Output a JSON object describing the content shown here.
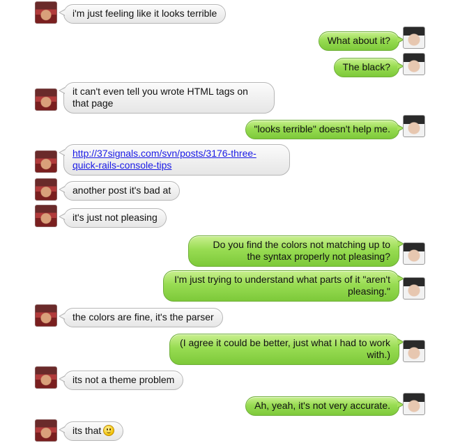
{
  "colors": {
    "them_bubble": "#e9e9e9",
    "me_bubble": "#8fd64a",
    "link": "#1a1ae6"
  },
  "messages": [
    {
      "from": "them",
      "text": "i'm just feeling like it looks terrible"
    },
    {
      "from": "me",
      "text": "What about it?"
    },
    {
      "from": "me",
      "text": "The black?"
    },
    {
      "from": "them",
      "text": "it can't even tell you wrote HTML tags on that page"
    },
    {
      "from": "me",
      "text": "\"looks terrible\" doesn't help me."
    },
    {
      "from": "them",
      "text": "http://37signals.com/svn/posts/3176-three-quick-rails-console-tips",
      "is_link": true
    },
    {
      "from": "them",
      "text": "another post it's bad at"
    },
    {
      "from": "them",
      "text": "it's just not pleasing"
    },
    {
      "from": "me",
      "text": "Do you find the colors not matching up to the syntax properly not pleasing?"
    },
    {
      "from": "me",
      "text": "I'm just trying to understand what parts of it \"aren't pleasing.\""
    },
    {
      "from": "them",
      "text": "the colors are fine, it's the parser"
    },
    {
      "from": "me",
      "text": "(I agree it could be better, just what I had to work with.)"
    },
    {
      "from": "them",
      "text": "its not a theme problem"
    },
    {
      "from": "me",
      "text": "Ah, yeah, it's not very accurate."
    },
    {
      "from": "them",
      "text": "its that",
      "emoji": "smiley-icon"
    }
  ]
}
